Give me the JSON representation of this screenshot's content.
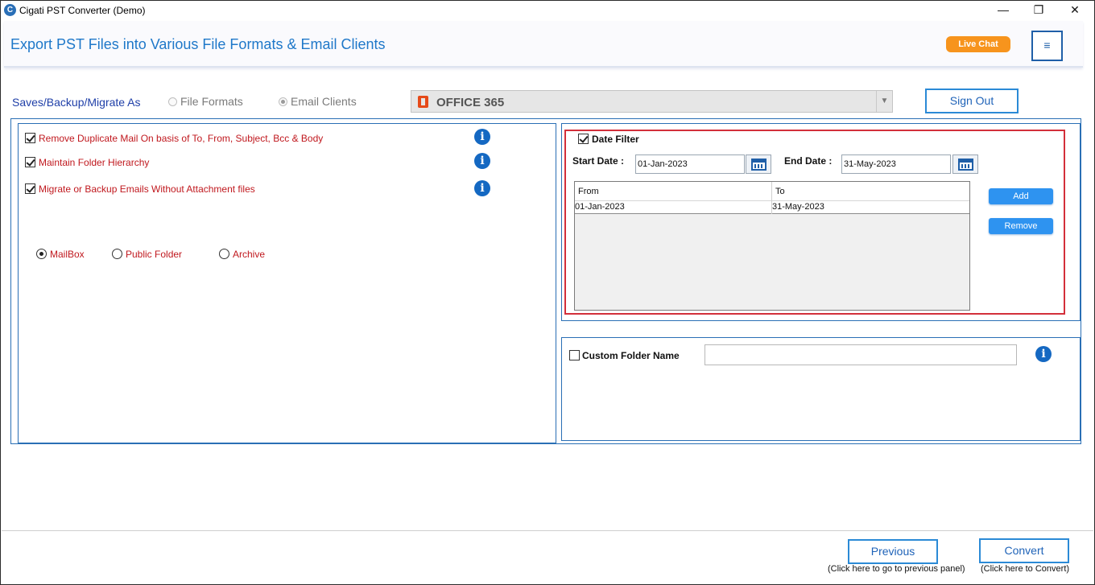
{
  "window": {
    "title": "Cigati PST Converter (Demo)",
    "app_icon_glyph": "C",
    "minimize_glyph": "—",
    "maximize_glyph": "❐",
    "close_glyph": "✕"
  },
  "header": {
    "title": "Export PST Files into Various File Formats & Email Clients",
    "live_chat_label": "Live Chat",
    "menu_glyph": "≡",
    "accent_color": "#1f78c9"
  },
  "save_as": {
    "label": "Saves/Backup/Migrate As",
    "option_file_formats": "File Formats",
    "option_email_clients": "Email Clients",
    "selected": "Email Clients",
    "client_value": "OFFICE 365",
    "client_icon": "office-365-icon",
    "sign_out_label": "Sign Out"
  },
  "options": {
    "items": [
      {
        "label": "Remove Duplicate Mail On basis of To, From, Subject, Bcc & Body",
        "checked": true
      },
      {
        "label": "Maintain Folder Hierarchy",
        "checked": true
      },
      {
        "label": "Migrate or Backup Emails Without Attachment files",
        "checked": true
      }
    ],
    "info_glyph": "i",
    "mailbox_types": [
      "MailBox",
      "Public Folder",
      "Archive"
    ],
    "selected_mailbox_type": "MailBox"
  },
  "date_filter": {
    "label": "Date Filter",
    "checked": true,
    "start_label": "Start Date :",
    "start_value": "01-Jan-2023",
    "end_label": "End Date :",
    "end_value": "31-May-2023",
    "columns": [
      "From",
      "To"
    ],
    "rows": [
      {
        "from": "01-Jan-2023",
        "to": "31-May-2023"
      }
    ],
    "add_label": "Add",
    "remove_label": "Remove"
  },
  "custom_folder": {
    "label": "Custom Folder Name",
    "checked": false,
    "value": ""
  },
  "footer": {
    "previous_label": "Previous",
    "previous_hint": "(Click here to go to previous panel)",
    "convert_label": "Convert",
    "convert_hint": "(Click here to Convert)"
  }
}
